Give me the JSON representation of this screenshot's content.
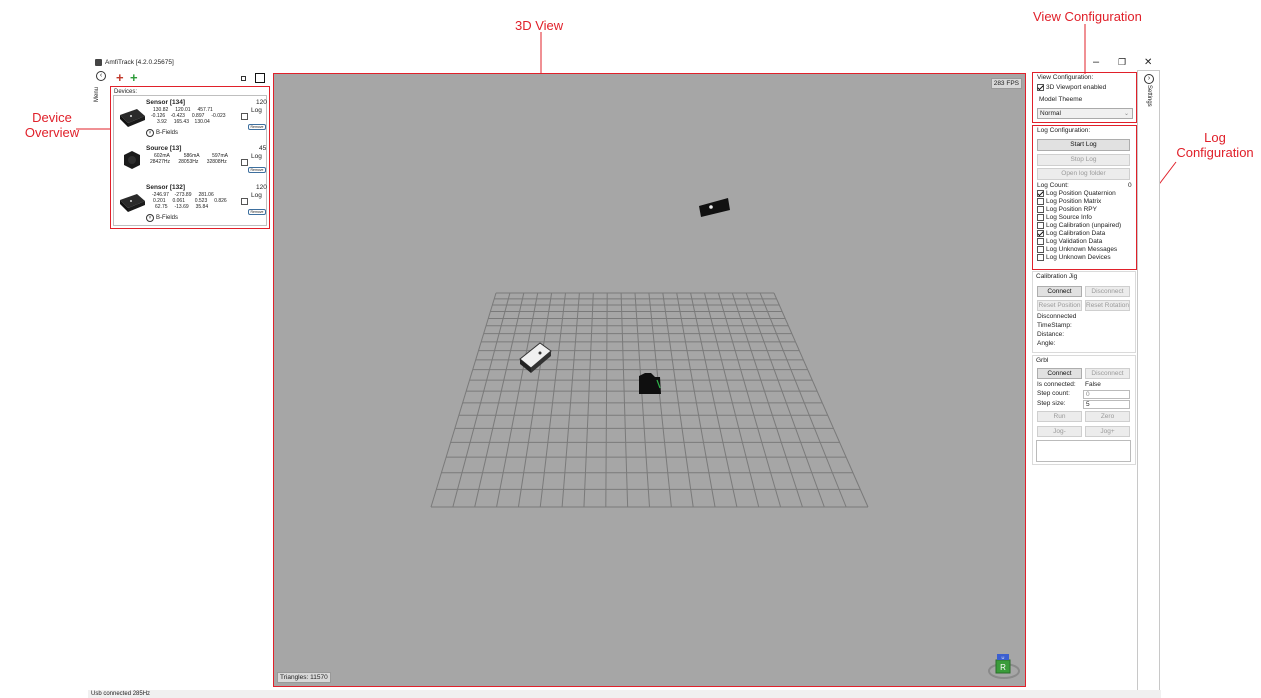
{
  "callouts": {
    "view3d": "3D View",
    "view_config": "View Configuration",
    "device_overview_line1": "Device",
    "device_overview_line2": "Overview",
    "log_config_line1": "Log",
    "log_config_line2": "Configuration"
  },
  "window": {
    "title": "AmfiTrack [4.2.0.25675]",
    "minimize": "–",
    "restore": "❐",
    "close": "✕"
  },
  "left": {
    "menu_label": "Menu",
    "devices_label": "Devices:",
    "devices": [
      {
        "name": "Sensor [134]",
        "count": "120",
        "row1": [
          "130.82",
          "120.01",
          "457.71"
        ],
        "row2": [
          "-0.126",
          "-0.423",
          "0.897",
          "-0.023"
        ],
        "row3": [
          "3.92",
          "165.43",
          "130.04"
        ],
        "log": "Log",
        "remove": "Remove",
        "bfields": "B-Fields"
      },
      {
        "name": "Source [13]",
        "count": "45",
        "row1": [
          "602mA",
          "586mA",
          "597mA"
        ],
        "row2": [
          "28427Hz",
          "28053Hz",
          "32808Hz"
        ],
        "log": "Log",
        "remove": "Remove"
      },
      {
        "name": "Sensor [132]",
        "count": "120",
        "row1": [
          "-246.97",
          "-273.89",
          "281.06"
        ],
        "row2": [
          "0.201",
          "0.061",
          "0.523",
          "0.826"
        ],
        "row3": [
          "62.75",
          "-13.69",
          "35.84"
        ],
        "log": "Log",
        "remove": "Remove",
        "bfields": "B-Fields"
      }
    ]
  },
  "viewport": {
    "fps": "283 FPS",
    "triangles": "Triangles: 11570",
    "gizmo_label": "R",
    "gizmo_top": "U"
  },
  "settings": {
    "tab_label": "Settings",
    "view_config": {
      "title": "View Configuration:",
      "viewport_enabled": "3D Viewport enabled",
      "model_theme_label": "Model Theeme",
      "model_theme_value": "Normal"
    },
    "log_config": {
      "title": "Log Configuration:",
      "start": "Start Log",
      "stop": "Stop Log",
      "open_folder": "Open log folder",
      "count_label": "Log Count:",
      "count_value": "0",
      "options": [
        {
          "label": "Log Position Quaternion",
          "checked": true
        },
        {
          "label": "Log Position Matrix",
          "checked": false
        },
        {
          "label": "Log Position RPY",
          "checked": false
        },
        {
          "label": "Log Source Info",
          "checked": false
        },
        {
          "label": "Log Calibration (unpaired)",
          "checked": false
        },
        {
          "label": "Log Calibration Data",
          "checked": true
        },
        {
          "label": "Log Validation Data",
          "checked": false
        },
        {
          "label": "Log Unknown Messages",
          "checked": false
        },
        {
          "label": "Log Unknown Devices",
          "checked": false
        }
      ]
    },
    "calibration_jig": {
      "title": "Calibration Jig",
      "connect": "Connect",
      "disconnect": "Disconnect",
      "reset_position": "Reset Position",
      "reset_rotation": "Reset Rotation",
      "status": "Disconnected",
      "timestamp": "TimeStamp:",
      "distance": "Distance:",
      "angle": "Angle:"
    },
    "grbl": {
      "title": "Grbl",
      "connect": "Connect",
      "disconnect": "Disconnect",
      "is_connected_label": "Is connected:",
      "is_connected_value": "False",
      "step_count_label": "Step count:",
      "step_count_value": "0",
      "step_size_label": "Step size:",
      "step_size_value": "5",
      "run": "Run",
      "zero": "Zero",
      "jog_minus": "Jog-",
      "jog_plus": "Jog+"
    }
  },
  "statusbar": {
    "text": "Usb connected 285Hz"
  },
  "colors": {
    "callout_red": "#e0202a",
    "viewport_bg": "#a6a6a6",
    "grid": "#7a7a7a"
  }
}
